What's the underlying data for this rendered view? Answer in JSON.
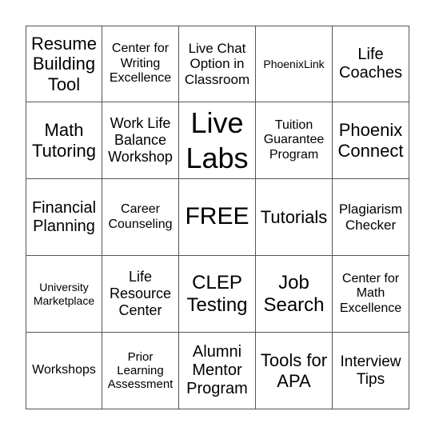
{
  "card": {
    "cells": [
      "Resume Building Tool",
      "Center for Writing Excellence",
      "Live Chat Option in Classroom",
      "PhoenixLink",
      "Life Coaches",
      "Math Tutoring",
      "Work Life Balance Workshop",
      "Live Labs",
      "Tuition Guarantee Program",
      "Phoenix Connect",
      "Financial Planning",
      "Career Counseling",
      "FREE",
      "Tutorials",
      "Plagiarism Checker",
      "University Marketplace",
      "Life Resource Center",
      "CLEP Testing",
      "Job Search",
      "Center for Math Excellence",
      "Workshops",
      "Prior Learning Assessment",
      "Alumni Mentor Program",
      "Tools for APA",
      "Interview Tips"
    ],
    "free_space": "FREE",
    "line_color": "#555555"
  }
}
